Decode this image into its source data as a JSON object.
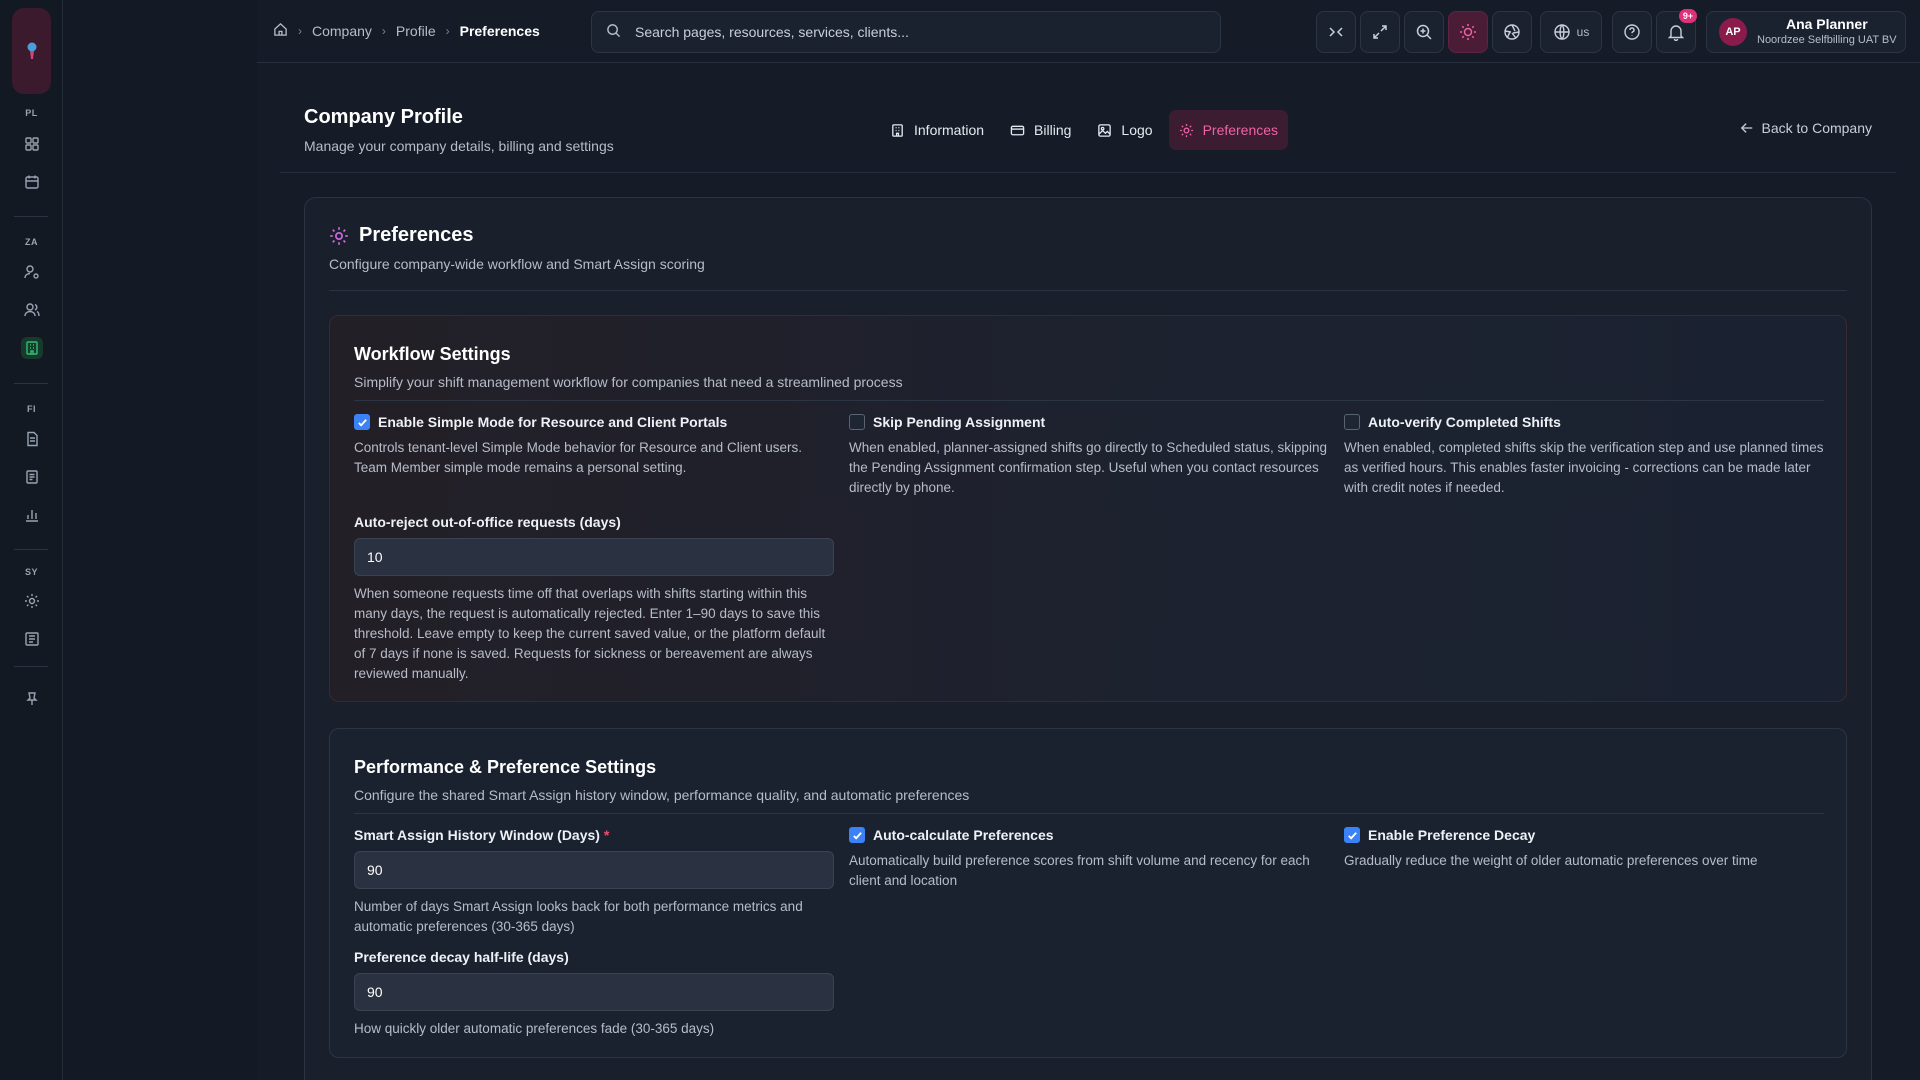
{
  "breadcrumb": {
    "items": [
      "Company",
      "Profile"
    ],
    "current": "Preferences"
  },
  "search": {
    "placeholder": "Search pages, resources, services, clients..."
  },
  "topbar": {
    "language": "us",
    "notification_badge": "9+",
    "user": {
      "initials": "AP",
      "name": "Ana Planner",
      "org": "Noordzee Selfbilling UAT BV"
    }
  },
  "rail": {
    "groups": [
      "PL",
      "ZA",
      "FI",
      "SY"
    ]
  },
  "page": {
    "title": "Company Profile",
    "subtitle": "Manage your company details, billing and settings",
    "back": "Back to Company",
    "tabs": [
      {
        "label": "Information",
        "icon": "building-icon"
      },
      {
        "label": "Billing",
        "icon": "credit-card-icon"
      },
      {
        "label": "Logo",
        "icon": "image-icon"
      },
      {
        "label": "Preferences",
        "icon": "gear-icon",
        "active": true
      }
    ]
  },
  "card": {
    "title": "Preferences",
    "subtitle": "Configure company-wide workflow and Smart Assign scoring"
  },
  "workflow": {
    "title": "Workflow Settings",
    "subtitle": "Simplify your shift management workflow for companies that need a streamlined process",
    "simple_mode": {
      "label": "Enable Simple Mode for Resource and Client Portals",
      "checked": true,
      "help": "Controls tenant-level Simple Mode behavior for Resource and Client users. Team Member simple mode remains a personal setting."
    },
    "skip_pending": {
      "label": "Skip Pending Assignment",
      "checked": false,
      "help": "When enabled, planner-assigned shifts go directly to Scheduled status, skipping the Pending Assignment confirmation step. Useful when you contact resources directly by phone."
    },
    "auto_verify": {
      "label": "Auto-verify Completed Shifts",
      "checked": false,
      "help": "When enabled, completed shifts skip the verification step and use planned times as verified hours. This enables faster invoicing - corrections can be made later with credit notes if needed."
    },
    "auto_reject": {
      "label": "Auto-reject out-of-office requests (days)",
      "value": "10",
      "help": "When someone requests time off that overlaps with shifts starting within this many days, the request is automatically rejected. Enter 1–90 days to save this threshold. Leave empty to keep the current saved value, or the platform default of 7 days if none is saved. Requests for sickness or bereavement are always reviewed manually."
    }
  },
  "performance": {
    "title": "Performance & Preference Settings",
    "subtitle": "Configure the shared Smart Assign history window, performance quality, and automatic preferences",
    "history_window": {
      "label": "Smart Assign History Window (Days)",
      "required_mark": "*",
      "value": "90",
      "help": "Number of days Smart Assign looks back for both performance metrics and automatic preferences (30-365 days)"
    },
    "decay_half_life": {
      "label": "Preference decay half-life (days)",
      "value": "90",
      "help": "How quickly older automatic preferences fade (30-365 days)"
    },
    "auto_calc": {
      "label": "Auto-calculate Preferences",
      "checked": true,
      "help": "Automatically build preference scores from shift volume and recency for each client and location"
    },
    "decay": {
      "label": "Enable Preference Decay",
      "checked": true,
      "help": "Gradually reduce the weight of older automatic preferences over time"
    }
  },
  "colors": {
    "accent_pink": "#f062a6",
    "checkbox_blue": "#3b82f6",
    "active_green": "#2fbf71",
    "required_red": "#f04d6b"
  }
}
